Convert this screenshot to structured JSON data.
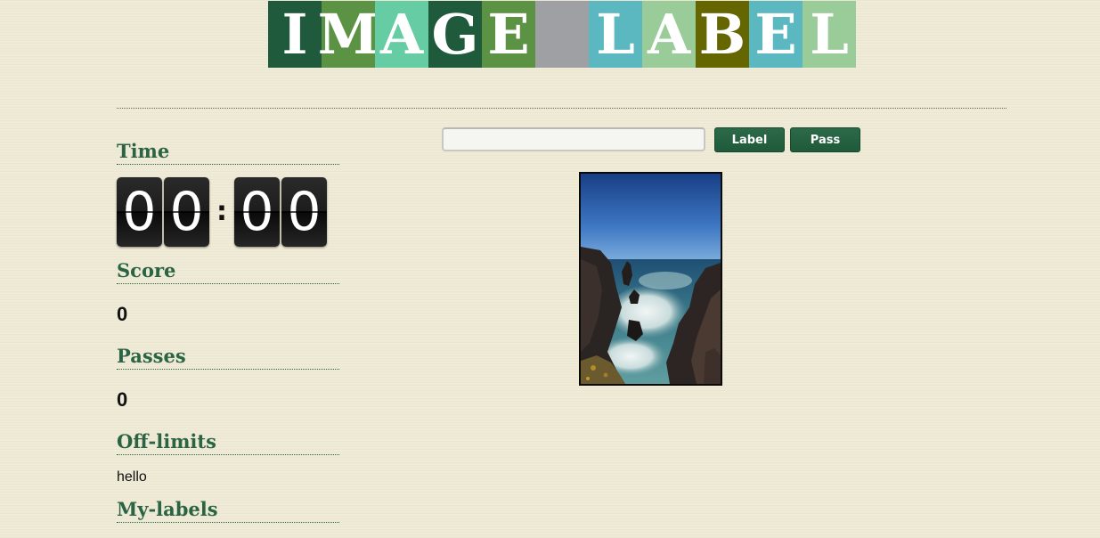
{
  "logo": {
    "tiles": [
      {
        "char": "I",
        "color": "#1f5a3d"
      },
      {
        "char": "M",
        "color": "#5c9244"
      },
      {
        "char": "A",
        "color": "#66cca3"
      },
      {
        "char": "G",
        "color": "#1f5a3d"
      },
      {
        "char": "E",
        "color": "#5c9244"
      },
      {
        "char": "",
        "color": "#9ea0a3"
      },
      {
        "char": "L",
        "color": "#5bb8c0"
      },
      {
        "char": "A",
        "color": "#99cc99"
      },
      {
        "char": "B",
        "color": "#666600"
      },
      {
        "char": "E",
        "color": "#5bb8c0"
      },
      {
        "char": "L",
        "color": "#99cc99"
      }
    ]
  },
  "sidebar": {
    "time_heading": "Time",
    "timer": {
      "m1": "0",
      "m2": "0",
      "colon": ":",
      "s1": "0",
      "s2": "0"
    },
    "score_heading": "Score",
    "score_value": "0",
    "passes_heading": "Passes",
    "passes_value": "0",
    "offlimits_heading": "Off-limits",
    "offlimits_items": [
      "hello"
    ],
    "mylabels_heading": "My-labels"
  },
  "controls": {
    "input_value": "",
    "label_button": "Label",
    "pass_button": "Pass"
  },
  "image": {
    "subject": "coastal sea stacks with long-exposure surf under blue sky"
  }
}
